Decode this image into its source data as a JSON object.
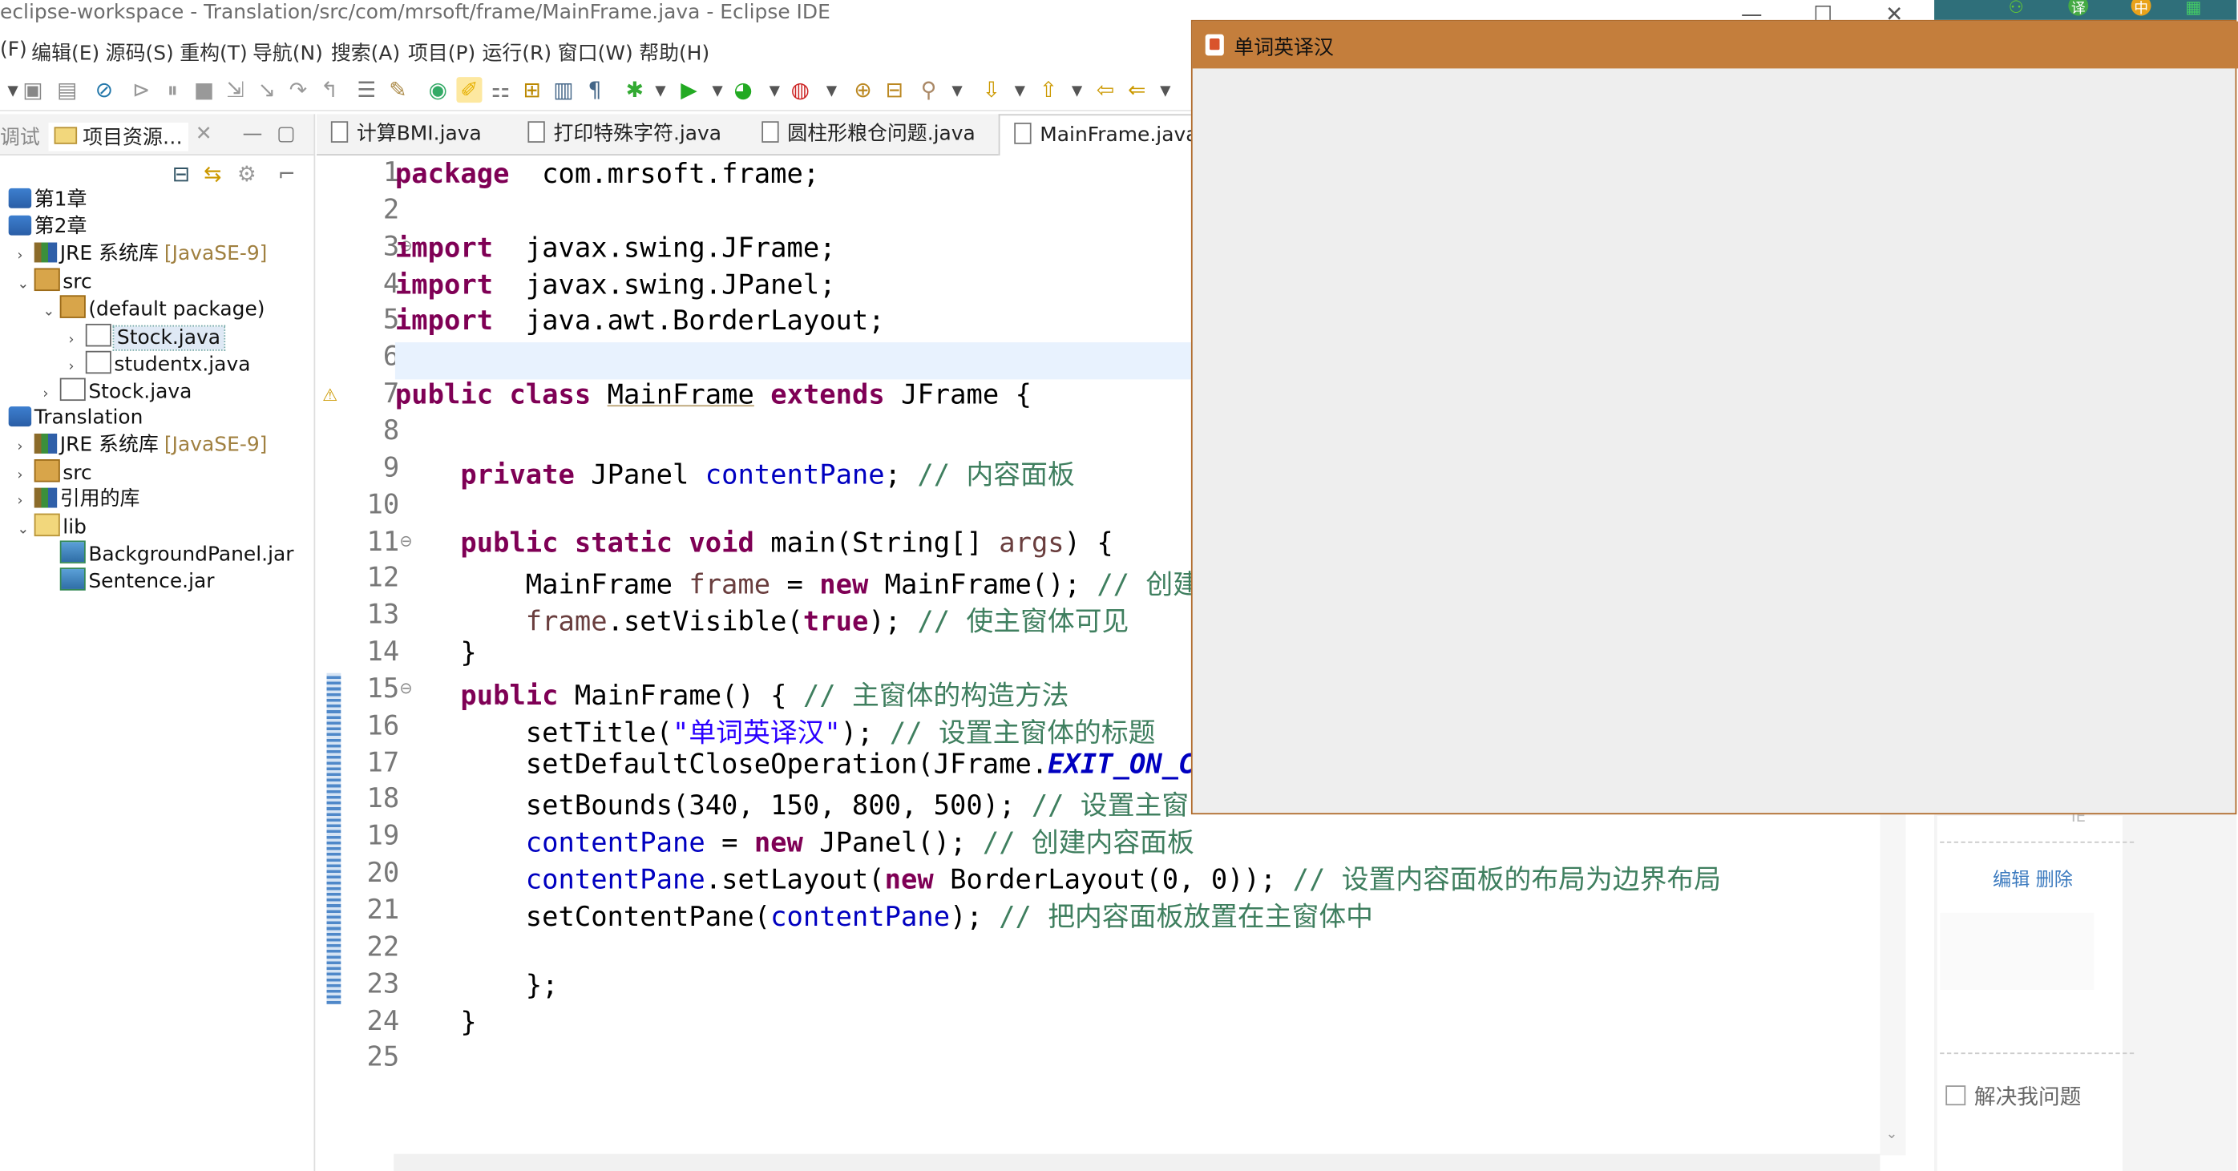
{
  "window": {
    "title": "eclipse-workspace - Translation/src/com/mrsoft/frame/MainFrame.java - Eclipse IDE",
    "minimize": "—",
    "maximize": "☐",
    "close": "✕"
  },
  "menu": [
    "(F)",
    "编辑(E)",
    "源码(S)",
    "重构(T)",
    "导航(N)",
    "搜索(A)",
    "项目(P)",
    "运行(R)",
    "窗口(W)",
    "帮助(H)"
  ],
  "left_panel": {
    "tabs": [
      "调试",
      "项目资源…"
    ],
    "tree": [
      {
        "text": "第1章",
        "icon": "project-icon",
        "depth": 0,
        "twisty": ""
      },
      {
        "text": "第2章",
        "icon": "project-icon",
        "depth": 0,
        "twisty": ""
      },
      {
        "text": "JRE 系统库",
        "suffix": "[JavaSE-9]",
        "icon": "library-icon",
        "depth": 1,
        "twisty": "›"
      },
      {
        "text": "src",
        "icon": "package-folder-icon",
        "depth": 1,
        "twisty": "⌄"
      },
      {
        "text": "(default package)",
        "icon": "package-icon",
        "depth": 2,
        "twisty": "⌄"
      },
      {
        "text": "Stock.java",
        "icon": "java-file-icon",
        "depth": 3,
        "twisty": "›",
        "selected": true
      },
      {
        "text": "studentx.java",
        "icon": "java-file-icon",
        "depth": 3,
        "twisty": "›"
      },
      {
        "text": "Stock.java",
        "icon": "java-file-icon",
        "depth": 2,
        "twisty": "›"
      },
      {
        "text": "Translation",
        "icon": "project-icon",
        "depth": 0,
        "twisty": ""
      },
      {
        "text": "JRE 系统库",
        "suffix": "[JavaSE-9]",
        "icon": "library-icon",
        "depth": 1,
        "twisty": "›"
      },
      {
        "text": "src",
        "icon": "package-folder-icon",
        "depth": 1,
        "twisty": "›"
      },
      {
        "text": "引用的库",
        "icon": "library-icon",
        "depth": 1,
        "twisty": "›"
      },
      {
        "text": "lib",
        "icon": "folder-icon",
        "depth": 1,
        "twisty": "⌄"
      },
      {
        "text": "BackgroundPanel.jar",
        "icon": "jar-icon",
        "depth": 2,
        "twisty": ""
      },
      {
        "text": "Sentence.jar",
        "icon": "jar-icon",
        "depth": 2,
        "twisty": ""
      }
    ]
  },
  "editor_tabs": [
    {
      "label": "计算BMI.java",
      "active": false
    },
    {
      "label": "打印特殊字符.java",
      "active": false
    },
    {
      "label": "圆柱形粮仓问题.java",
      "active": false
    },
    {
      "label": "MainFrame.java",
      "active": true
    }
  ],
  "code": [
    [
      [
        "kw",
        "package"
      ],
      [
        "",
        "  com.mrsoft.frame;"
      ]
    ],
    [],
    [
      [
        "kw",
        "import"
      ],
      [
        "",
        "  javax.swing.JFrame;"
      ]
    ],
    [
      [
        "kw",
        "import"
      ],
      [
        "",
        "  javax.swing.JPanel;"
      ]
    ],
    [
      [
        "kw",
        "import"
      ],
      [
        "",
        "  java.awt.BorderLayout;"
      ]
    ],
    [],
    [
      [
        "kw",
        "public"
      ],
      [
        "",
        " "
      ],
      [
        "kw",
        "class"
      ],
      [
        "",
        " "
      ],
      [
        "ul",
        "MainFrame"
      ],
      [
        "",
        " "
      ],
      [
        "kw",
        "extends"
      ],
      [
        "",
        " JFrame {"
      ]
    ],
    [],
    [
      [
        "",
        "    "
      ],
      [
        "kw",
        "private"
      ],
      [
        "",
        " JPanel "
      ],
      [
        "fld",
        "contentPane"
      ],
      [
        "",
        ";"
      ],
      [
        "cm",
        " // 内容面板"
      ]
    ],
    [],
    [
      [
        "",
        "    "
      ],
      [
        "kw",
        "public"
      ],
      [
        "",
        " "
      ],
      [
        "kw",
        "static"
      ],
      [
        "",
        " "
      ],
      [
        "kw",
        "void"
      ],
      [
        "",
        " main(String[] "
      ],
      [
        "param",
        "args"
      ],
      [
        "",
        ") {"
      ]
    ],
    [
      [
        "",
        "        MainFrame "
      ],
      [
        "param",
        "frame"
      ],
      [
        "",
        " = "
      ],
      [
        "kw",
        "new"
      ],
      [
        "",
        " MainFrame(); "
      ],
      [
        "cm",
        "// 创建"
      ]
    ],
    [
      [
        "",
        "        "
      ],
      [
        "param",
        "frame"
      ],
      [
        "",
        ".setVisible("
      ],
      [
        "kw",
        "true"
      ],
      [
        "",
        "); "
      ],
      [
        "cm",
        "// 使主窗体可见"
      ]
    ],
    [
      [
        "",
        "    }"
      ]
    ],
    [
      [
        "",
        "    "
      ],
      [
        "kw",
        "public"
      ],
      [
        "",
        " MainFrame() { "
      ],
      [
        "cm",
        "// 主窗体的构造方法"
      ]
    ],
    [
      [
        "",
        "        setTitle("
      ],
      [
        "str",
        "\"单词英译汉\""
      ],
      [
        "",
        "); "
      ],
      [
        "cm",
        "// 设置主窗体的标题"
      ]
    ],
    [
      [
        "",
        "        setDefaultCloseOperation(JFrame."
      ],
      [
        "cst",
        "EXIT_ON_CL"
      ]
    ],
    [
      [
        "",
        "        setBounds(340, 150, 800, 500); "
      ],
      [
        "cm",
        "// 设置主窗"
      ]
    ],
    [
      [
        "",
        "        "
      ],
      [
        "fld",
        "contentPane"
      ],
      [
        "",
        " = "
      ],
      [
        "kw",
        "new"
      ],
      [
        "",
        " JPanel(); "
      ],
      [
        "cm",
        "// 创建内容面板"
      ]
    ],
    [
      [
        "",
        "        "
      ],
      [
        "fld",
        "contentPane"
      ],
      [
        "",
        ".setLayout("
      ],
      [
        "kw",
        "new"
      ],
      [
        "",
        " BorderLayout(0, 0)); "
      ],
      [
        "cm",
        "// 设置内容面板的布局为边界布局"
      ]
    ],
    [
      [
        "",
        "        setContentPane("
      ],
      [
        "fld",
        "contentPane"
      ],
      [
        "",
        "); "
      ],
      [
        "cm",
        "// 把内容面板放置在主窗体中"
      ]
    ],
    [],
    [
      [
        "",
        "        };"
      ]
    ],
    [
      [
        "",
        "    }"
      ]
    ],
    []
  ],
  "line_numbers": [
    "1",
    "2",
    "3",
    "4",
    "5",
    "6",
    "7",
    "8",
    "9",
    "10",
    "11",
    "12",
    "13",
    "14",
    "15",
    "16",
    "17",
    "18",
    "19",
    "20",
    "21",
    "22",
    "23",
    "24",
    "25"
  ],
  "fold_lines": [
    3,
    11,
    15
  ],
  "right_panel": {
    "edit_links": "编辑  删除",
    "solve": "解决我问题",
    "partial": "IE"
  },
  "app_window": {
    "title": "单词英译汉"
  }
}
